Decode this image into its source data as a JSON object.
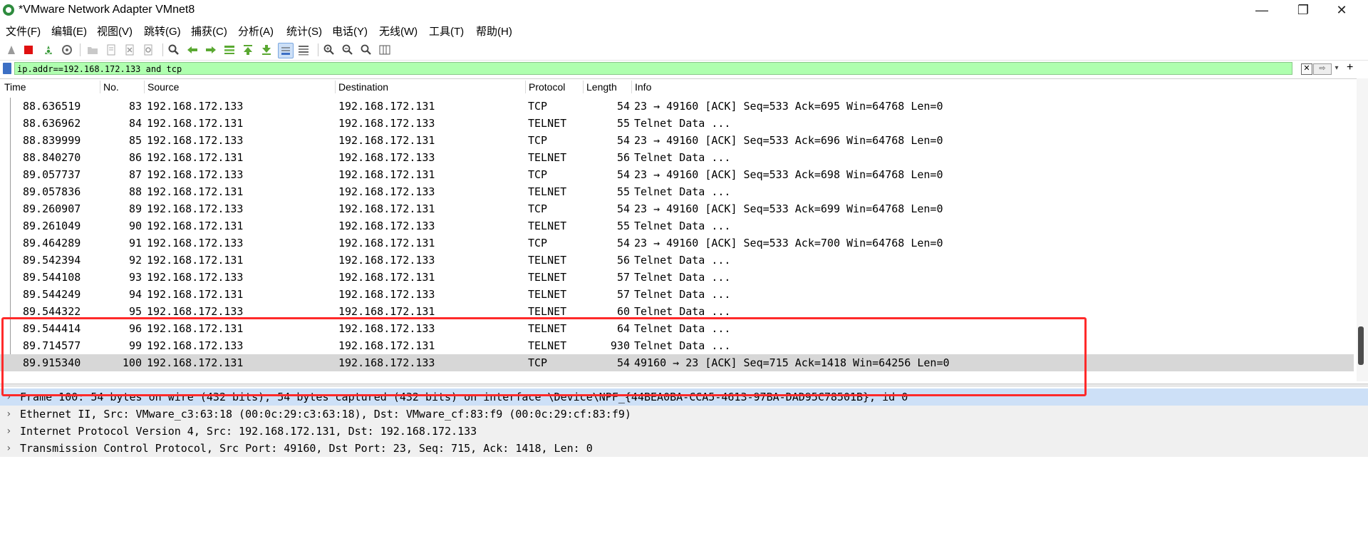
{
  "window": {
    "title": "*VMware Network Adapter VMnet8",
    "minimize": "—",
    "maximize": "❐",
    "close": "✕"
  },
  "menu": [
    "文件(F)",
    "编辑(E)",
    "视图(V)",
    "跳转(G)",
    "捕获(C)",
    "分析(A)",
    "统计(S)",
    "电话(Y)",
    "无线(W)",
    "工具(T)",
    "帮助(H)"
  ],
  "filter": {
    "value": "ip.addr==192.168.172.133 and tcp"
  },
  "columns": [
    "Time",
    "No.",
    "Source",
    "Destination",
    "Protocol",
    "Length",
    "Info"
  ],
  "packets": [
    {
      "time": "88.636519",
      "no": "83",
      "src": "192.168.172.133",
      "dst": "192.168.172.131",
      "proto": "TCP",
      "len": "54",
      "info": "23 → 49160 [ACK] Seq=533 Ack=695 Win=64768 Len=0"
    },
    {
      "time": "88.636962",
      "no": "84",
      "src": "192.168.172.131",
      "dst": "192.168.172.133",
      "proto": "TELNET",
      "len": "55",
      "info": "Telnet Data ..."
    },
    {
      "time": "88.839999",
      "no": "85",
      "src": "192.168.172.133",
      "dst": "192.168.172.131",
      "proto": "TCP",
      "len": "54",
      "info": "23 → 49160 [ACK] Seq=533 Ack=696 Win=64768 Len=0"
    },
    {
      "time": "88.840270",
      "no": "86",
      "src": "192.168.172.131",
      "dst": "192.168.172.133",
      "proto": "TELNET",
      "len": "56",
      "info": "Telnet Data ..."
    },
    {
      "time": "89.057737",
      "no": "87",
      "src": "192.168.172.133",
      "dst": "192.168.172.131",
      "proto": "TCP",
      "len": "54",
      "info": "23 → 49160 [ACK] Seq=533 Ack=698 Win=64768 Len=0"
    },
    {
      "time": "89.057836",
      "no": "88",
      "src": "192.168.172.131",
      "dst": "192.168.172.133",
      "proto": "TELNET",
      "len": "55",
      "info": "Telnet Data ..."
    },
    {
      "time": "89.260907",
      "no": "89",
      "src": "192.168.172.133",
      "dst": "192.168.172.131",
      "proto": "TCP",
      "len": "54",
      "info": "23 → 49160 [ACK] Seq=533 Ack=699 Win=64768 Len=0"
    },
    {
      "time": "89.261049",
      "no": "90",
      "src": "192.168.172.131",
      "dst": "192.168.172.133",
      "proto": "TELNET",
      "len": "55",
      "info": "Telnet Data ..."
    },
    {
      "time": "89.464289",
      "no": "91",
      "src": "192.168.172.133",
      "dst": "192.168.172.131",
      "proto": "TCP",
      "len": "54",
      "info": "23 → 49160 [ACK] Seq=533 Ack=700 Win=64768 Len=0"
    },
    {
      "time": "89.542394",
      "no": "92",
      "src": "192.168.172.131",
      "dst": "192.168.172.133",
      "proto": "TELNET",
      "len": "56",
      "info": "Telnet Data ..."
    },
    {
      "time": "89.544108",
      "no": "93",
      "src": "192.168.172.133",
      "dst": "192.168.172.131",
      "proto": "TELNET",
      "len": "57",
      "info": "Telnet Data ..."
    },
    {
      "time": "89.544249",
      "no": "94",
      "src": "192.168.172.131",
      "dst": "192.168.172.133",
      "proto": "TELNET",
      "len": "57",
      "info": "Telnet Data ..."
    },
    {
      "time": "89.544322",
      "no": "95",
      "src": "192.168.172.133",
      "dst": "192.168.172.131",
      "proto": "TELNET",
      "len": "60",
      "info": "Telnet Data ..."
    },
    {
      "time": "89.544414",
      "no": "96",
      "src": "192.168.172.131",
      "dst": "192.168.172.133",
      "proto": "TELNET",
      "len": "64",
      "info": "Telnet Data ..."
    },
    {
      "time": "89.714577",
      "no": "99",
      "src": "192.168.172.133",
      "dst": "192.168.172.131",
      "proto": "TELNET",
      "len": "930",
      "info": "Telnet Data ..."
    },
    {
      "time": "89.915340",
      "no": "100",
      "src": "192.168.172.131",
      "dst": "192.168.172.133",
      "proto": "TCP",
      "len": "54",
      "info": "49160 → 23 [ACK] Seq=715 Ack=1418 Win=64256 Len=0"
    }
  ],
  "details": [
    "Frame 100: 54 bytes on wire (432 bits), 54 bytes captured (432 bits) on interface \\Device\\NPF_{44BEA0BA-CCA5-4613-97BA-DAD95C78501B}, id 0",
    "Ethernet II, Src: VMware_c3:63:18 (00:0c:29:c3:63:18), Dst: VMware_cf:83:f9 (00:0c:29:cf:83:f9)",
    "Internet Protocol Version 4, Src: 192.168.172.131, Dst: 192.168.172.133",
    "Transmission Control Protocol, Src Port: 49160, Dst Port: 23, Seq: 715, Ack: 1418, Len: 0"
  ],
  "colors": {
    "filter_valid": "#afffaf",
    "selected_row": "#d7d7d7",
    "selected_detail": "#cde0f7",
    "annotation": "#ff2a2a"
  }
}
